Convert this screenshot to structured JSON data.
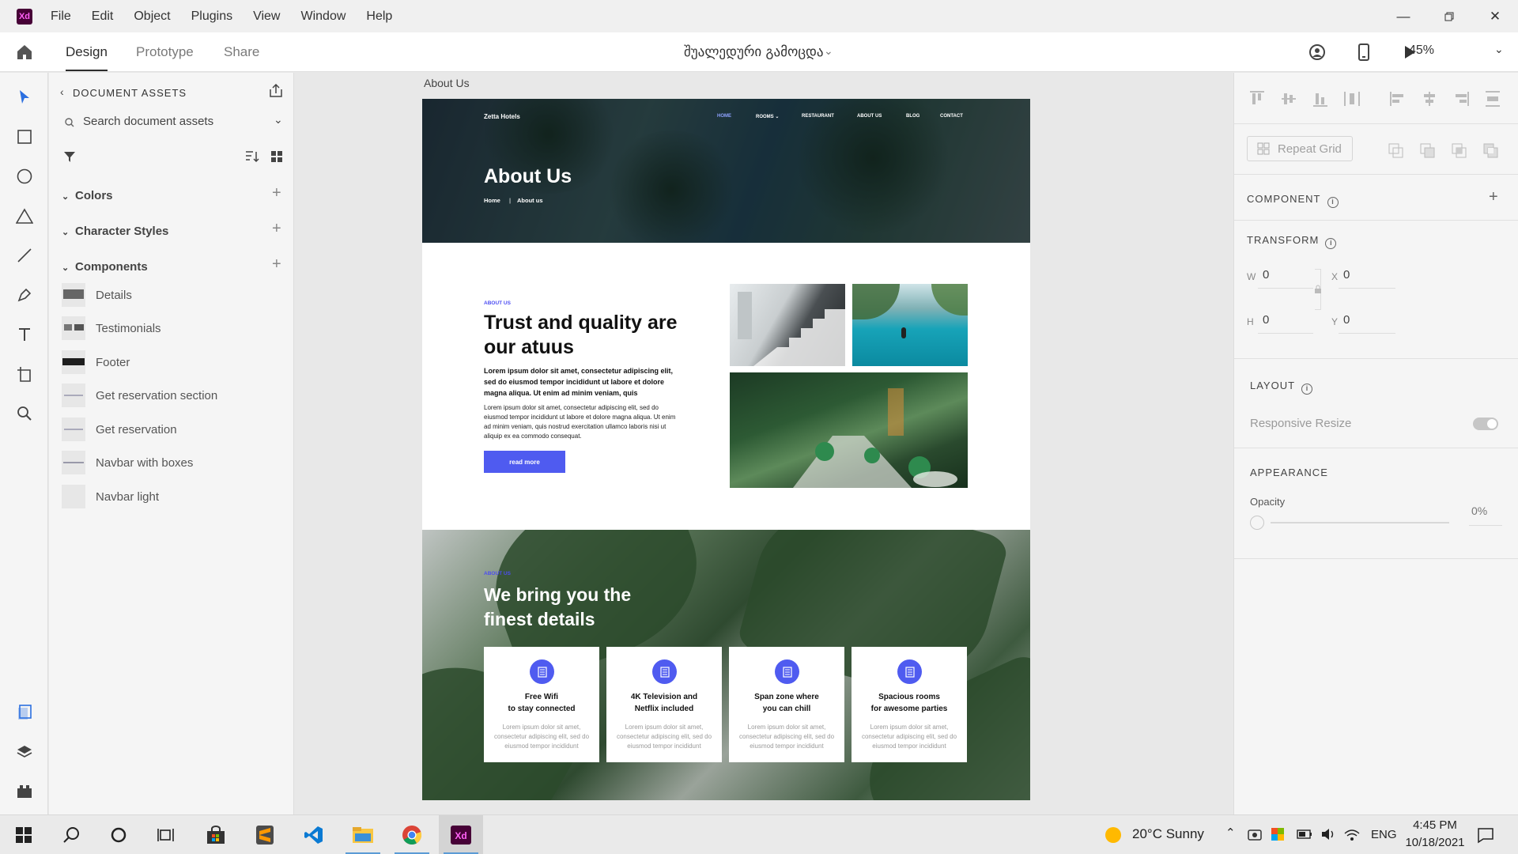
{
  "menubar": {
    "logo": "Xd",
    "items": [
      "File",
      "Edit",
      "Object",
      "Plugins",
      "View",
      "Window",
      "Help"
    ]
  },
  "header": {
    "tabs": [
      "Design",
      "Prototype",
      "Share"
    ],
    "active_tab": "Design",
    "document_title": "შუალედური გამოცდა",
    "zoom": "45%"
  },
  "assets": {
    "title": "DOCUMENT ASSETS",
    "search_placeholder": "Search document assets",
    "sections": [
      "Colors",
      "Character Styles",
      "Components"
    ],
    "components": [
      "Details",
      "Testimonials",
      "Footer",
      "Get reservation section",
      "Get reservation",
      "Navbar with boxes",
      "Navbar light"
    ]
  },
  "canvas": {
    "artboard_name": "About Us",
    "hero": {
      "brand": "Zetta Hotels",
      "nav": [
        "HOME",
        "ROOMS ⌄",
        "RESTAURANT",
        "ABOUT US",
        "BLOG",
        "CONTACT"
      ],
      "title": "About Us",
      "crumb_home": "Home",
      "crumb_current": "About us"
    },
    "about": {
      "tag": "ABOUT US",
      "title": "Trust and quality are our atuus",
      "p1": "Lorem ipsum dolor sit amet, consectetur adipiscing elit, sed do eiusmod tempor incididunt ut labore et dolore magna aliqua. Ut enim ad minim veniam, quis",
      "p2": "Lorem ipsum dolor sit amet, consectetur adipiscing elit, sed do eiusmod tempor incididunt ut labore et dolore magna aliqua. Ut enim ad minim veniam, quis nostrud exercitation ullamco laboris nisi ut aliquip ex ea commodo consequat.",
      "button": "read more"
    },
    "details": {
      "tag": "ABOUT US",
      "title": "We bring you the finest details",
      "cards": [
        {
          "line1": "Free Wifi",
          "line2": "to stay connected",
          "desc": "Lorem ipsum dolor sit amet, consectetur adipiscing elit, sed do eiusmod tempor incididunt"
        },
        {
          "line1": "4K Television and",
          "line2": "Netflix included",
          "desc": "Lorem ipsum dolor sit amet, consectetur adipiscing elit, sed do eiusmod tempor incididunt"
        },
        {
          "line1": "Span zone where",
          "line2": "you can chill",
          "desc": "Lorem ipsum dolor sit amet, consectetur adipiscing elit, sed do eiusmod tempor incididunt"
        },
        {
          "line1": "Spacious rooms",
          "line2": "for awesome parties",
          "desc": "Lorem ipsum dolor sit amet, consectetur adipiscing elit, sed do eiusmod tempor incididunt"
        }
      ]
    }
  },
  "properties": {
    "repeat_grid": "Repeat Grid",
    "component_label": "COMPONENT",
    "transform_label": "TRANSFORM",
    "w_label": "W",
    "w_value": "0",
    "x_label": "X",
    "x_value": "0",
    "h_label": "H",
    "h_value": "0",
    "y_label": "Y",
    "y_value": "0",
    "layout_label": "LAYOUT",
    "responsive_resize": "Responsive Resize",
    "appearance_label": "APPEARANCE",
    "opacity_label": "Opacity",
    "opacity_value": "0%"
  },
  "taskbar": {
    "weather": "20°C  Sunny",
    "lang": "ENG",
    "time": "4:45 PM",
    "date": "10/18/2021"
  },
  "colors": {
    "accent": "#4f5bf0",
    "xd_brand": "#470137"
  }
}
